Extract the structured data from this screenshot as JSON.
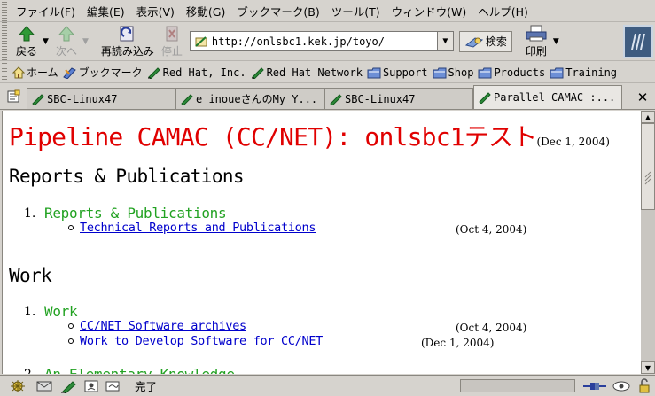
{
  "menu": [
    "ファイル(F)",
    "編集(E)",
    "表示(V)",
    "移動(G)",
    "ブックマーク(B)",
    "ツール(T)",
    "ウィンドウ(W)",
    "ヘルプ(H)"
  ],
  "nav": {
    "back": "戻る",
    "forward": "次へ",
    "reload": "再読み込み",
    "stop": "停止",
    "url": "http://onlsbc1.kek.jp/toyo/",
    "search": "検索",
    "print": "印刷"
  },
  "bookmarks": [
    "ホーム",
    "ブックマーク",
    "Red Hat, Inc.",
    "Red Hat Network",
    "Support",
    "Shop",
    "Products",
    "Training"
  ],
  "tabs": [
    "SBC-Linux47",
    "e_inoueさんのMy Y...",
    "SBC-Linux47",
    "Parallel CAMAC :..."
  ],
  "page": {
    "title": "Pipeline CAMAC (CC/NET): onlsbc1テスト",
    "title_date": "(Dec 1, 2004)",
    "sections": [
      {
        "heading": "Reports & Publications",
        "num": "1.",
        "item": "Reports & Publications",
        "links": [
          {
            "text": "Technical Reports and Publications",
            "date": "(Oct 4, 2004)"
          }
        ]
      },
      {
        "heading": "Work",
        "num": "1.",
        "item": "Work",
        "links": [
          {
            "text": "CC/NET Software archives",
            "date": "(Oct 4, 2004)"
          },
          {
            "text": "Work to Develop Software for CC/NET",
            "date": "(Dec 1, 2004)"
          }
        ]
      }
    ],
    "next_num": "2.",
    "next_item": "An Elementary Knowledge"
  },
  "status": {
    "text": "完了"
  }
}
